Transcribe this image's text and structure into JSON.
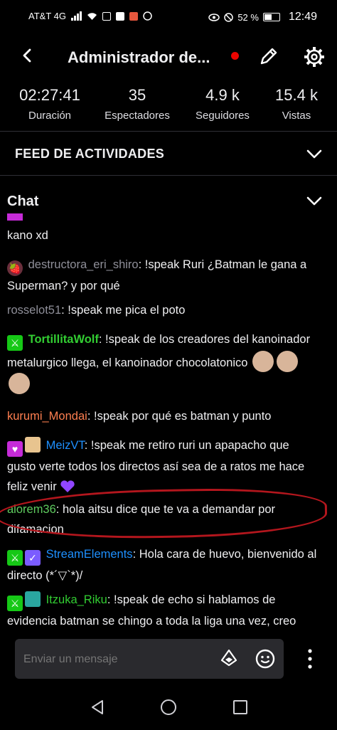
{
  "status_bar": {
    "carrier": "AT&T 4G",
    "battery_percent": "52 %",
    "time": "12:49"
  },
  "header": {
    "title": "Administrador de..."
  },
  "stats": [
    {
      "value": "02:27:41",
      "label": "Duración"
    },
    {
      "value": "35",
      "label": "Espectadores"
    },
    {
      "value": "4.9 k",
      "label": "Seguidores"
    },
    {
      "value": "15.4 k",
      "label": "Vistas"
    }
  ],
  "activity_feed": {
    "label": "FEED DE ACTIVIDADES"
  },
  "chat": {
    "label": "Chat",
    "messages": [
      {
        "user": "",
        "text": "kano xd",
        "color": "#efeff1"
      },
      {
        "user": "destructora_eri_shiro",
        "text": ": !speak Ruri ¿Batman le gana a Superman? y por qué",
        "color": "#8f8f99"
      },
      {
        "user": "rosselot51",
        "text": ": !speak me pica el poto",
        "color": "#8f8f99"
      },
      {
        "user": "TortillitaWolf",
        "text": ": !speak de los creadores del kanoinador metalurgico llega, el kanoinador chocolatonico",
        "color": "#32cd32"
      },
      {
        "user": "kurumi_Mondai",
        "text": ": !speak por qué es batman y punto",
        "color": "#ff7f50"
      },
      {
        "user": "MeizVT",
        "text": ": !speak me retiro ruri un apapacho que gusto verte todos los directos así sea de a ratos me hace feliz venir",
        "color": "#1e90ff"
      },
      {
        "user": "alorem36",
        "text": ": hola aitsu dice que te va a demandar por difamacion",
        "color": "#5ecb5e"
      },
      {
        "user": "StreamElements",
        "text": ": Hola cara de huevo, bienvenido al directo (*´▽`*)/",
        "color": "#1e90ff"
      },
      {
        "user": "Itzuka_Riku",
        "text": ": !speak de echo si hablamos de evidencia batman se chingo a toda la liga una vez, creo",
        "color": "#32cd32"
      }
    ]
  },
  "composer": {
    "placeholder": "Enviar un mensaje"
  },
  "colors": {
    "live": "#eb0400",
    "annotation": "#b3161d"
  }
}
